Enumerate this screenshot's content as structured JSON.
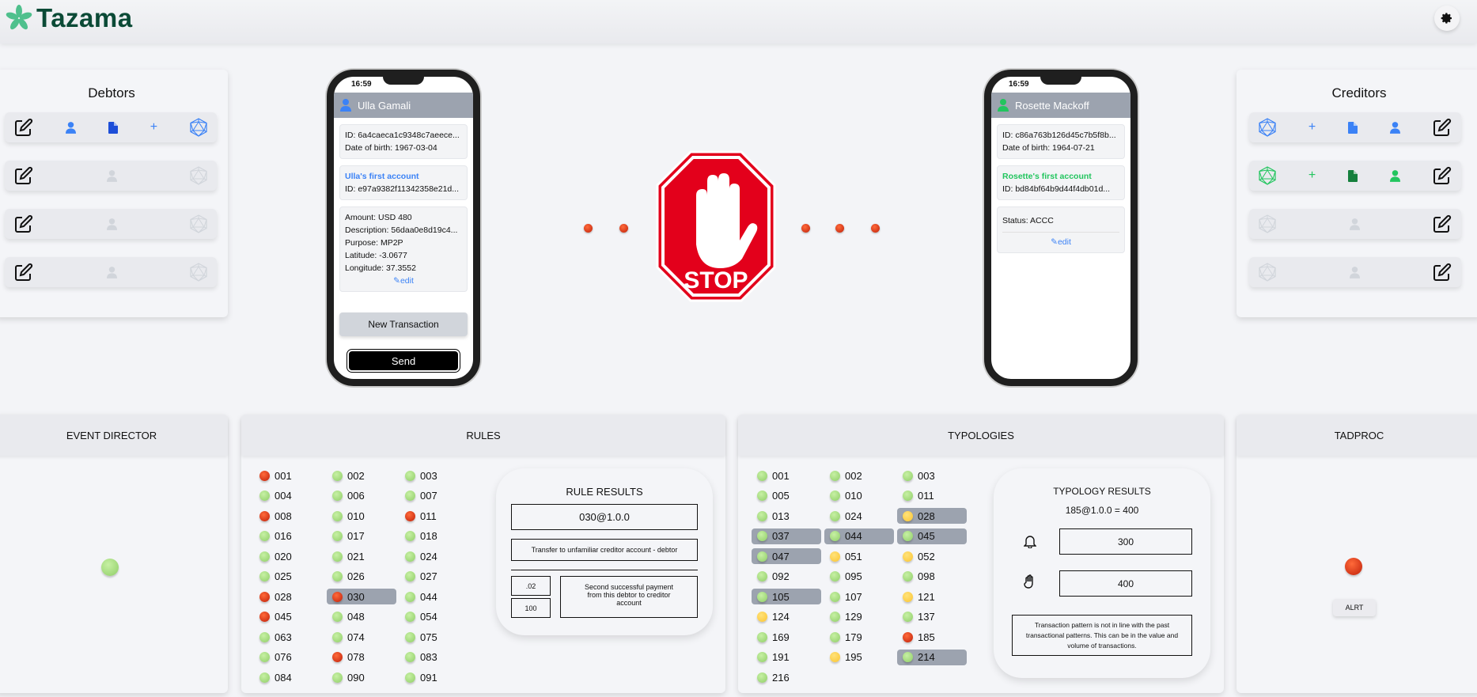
{
  "header": {
    "brand": "Tazama",
    "settings_icon": "gear-icon"
  },
  "debtors": {
    "title": "Debtors",
    "rows": [
      {
        "active": true
      },
      {
        "active": false
      },
      {
        "active": false
      },
      {
        "active": false
      }
    ]
  },
  "creditors": {
    "title": "Creditors",
    "rows": [
      {
        "active": true,
        "color": "#3b82f6"
      },
      {
        "active": true,
        "color": "#22c55e"
      },
      {
        "active": false
      },
      {
        "active": false
      }
    ]
  },
  "debtor_phone": {
    "time": "16:59",
    "name": "Ulla Gamali",
    "id": "ID: 6a4caeca1c9348c7aeece...",
    "dob": "Date of birth: 1967-03-04",
    "account_name": "Ulla's first account",
    "account_id": "ID: e97a9382f11342358e21d...",
    "amount": "Amount: USD 480",
    "description": "Description: 56daa0e8d19c4...",
    "purpose": "Purpose: MP2P",
    "latitude": "Latitude: -3.0677",
    "longitude": "Longitude: 37.3552",
    "edit": "edit",
    "new_transaction": "New Transaction",
    "send": "Send"
  },
  "creditor_phone": {
    "time": "16:59",
    "name": "Rosette Mackoff",
    "id": "ID: c86a763b126d45c7b5f8b...",
    "dob": "Date of birth: 1964-07-21",
    "account_name": "Rosette's first account",
    "account_id": "ID: bd84bf64b9d44f4db01d...",
    "status": "Status: ACCC",
    "edit": "edit"
  },
  "stop_sign": {
    "text": "STOP",
    "color": "#e3001b"
  },
  "colors": {
    "accent_blue": "#3b82f6",
    "accent_green": "#22c55e",
    "red": "#d9280f",
    "green": "#9ed97a",
    "yellow": "#fcd34d",
    "highlight": "#9ca3af"
  },
  "event_director": {
    "title": "EVENT DIRECTOR",
    "status": "green"
  },
  "rules": {
    "title": "RULES",
    "items": [
      [
        "001",
        "r",
        0
      ],
      [
        "002",
        "g",
        0
      ],
      [
        "003",
        "g",
        0
      ],
      [
        "004",
        "g",
        0
      ],
      [
        "006",
        "g",
        0
      ],
      [
        "007",
        "g",
        0
      ],
      [
        "008",
        "r",
        0
      ],
      [
        "010",
        "g",
        0
      ],
      [
        "011",
        "r",
        0
      ],
      [
        "016",
        "g",
        0
      ],
      [
        "017",
        "g",
        0
      ],
      [
        "018",
        "g",
        0
      ],
      [
        "020",
        "g",
        0
      ],
      [
        "021",
        "g",
        0
      ],
      [
        "024",
        "g",
        0
      ],
      [
        "025",
        "g",
        0
      ],
      [
        "026",
        "g",
        0
      ],
      [
        "027",
        "g",
        0
      ],
      [
        "028",
        "r",
        0
      ],
      [
        "030",
        "r",
        1
      ],
      [
        "044",
        "g",
        0
      ],
      [
        "045",
        "r",
        0
      ],
      [
        "048",
        "g",
        0
      ],
      [
        "054",
        "g",
        0
      ],
      [
        "063",
        "g",
        0
      ],
      [
        "074",
        "g",
        0
      ],
      [
        "075",
        "g",
        0
      ],
      [
        "076",
        "g",
        0
      ],
      [
        "078",
        "r",
        0
      ],
      [
        "083",
        "g",
        0
      ],
      [
        "084",
        "g",
        0
      ],
      [
        "090",
        "g",
        0
      ],
      [
        "091",
        "g",
        0
      ]
    ],
    "results": {
      "title": "RULE RESULTS",
      "rule": "030@1.0.0",
      "description": "Transfer to unfamiliar creditor account - debtor",
      "sub_rule": ".02",
      "score": "100",
      "reason": "Second successful payment from this debtor to creditor account"
    }
  },
  "typologies": {
    "title": "TYPOLOGIES",
    "items": [
      [
        "001",
        "g",
        0
      ],
      [
        "002",
        "g",
        0
      ],
      [
        "003",
        "g",
        0
      ],
      [
        "005",
        "g",
        0
      ],
      [
        "010",
        "g",
        0
      ],
      [
        "011",
        "g",
        0
      ],
      [
        "013",
        "g",
        0
      ],
      [
        "024",
        "g",
        0
      ],
      [
        "028",
        "y",
        1
      ],
      [
        "037",
        "g",
        1
      ],
      [
        "044",
        "g",
        1
      ],
      [
        "045",
        "g",
        1
      ],
      [
        "047",
        "g",
        1
      ],
      [
        "051",
        "y",
        0
      ],
      [
        "052",
        "y",
        0
      ],
      [
        "092",
        "g",
        0
      ],
      [
        "095",
        "g",
        0
      ],
      [
        "098",
        "g",
        0
      ],
      [
        "105",
        "g",
        1
      ],
      [
        "107",
        "g",
        0
      ],
      [
        "121",
        "y",
        0
      ],
      [
        "124",
        "y",
        0
      ],
      [
        "129",
        "g",
        0
      ],
      [
        "137",
        "g",
        0
      ],
      [
        "169",
        "g",
        0
      ],
      [
        "179",
        "g",
        0
      ],
      [
        "185",
        "r",
        0
      ],
      [
        "191",
        "g",
        0
      ],
      [
        "195",
        "y",
        0
      ],
      [
        "214",
        "g",
        1
      ],
      [
        "216",
        "g",
        0
      ]
    ],
    "results": {
      "title": "TYPOLOGY RESULTS",
      "summary": "185@1.0.0 = 400",
      "alert_threshold": "300",
      "interdiction_threshold": "400",
      "description": "Transaction pattern is not in line with the past transactional patterns. This can be in the value and volume of transactions."
    }
  },
  "tadproc": {
    "title": "TADPROC",
    "status": "red",
    "button": "ALRT"
  }
}
